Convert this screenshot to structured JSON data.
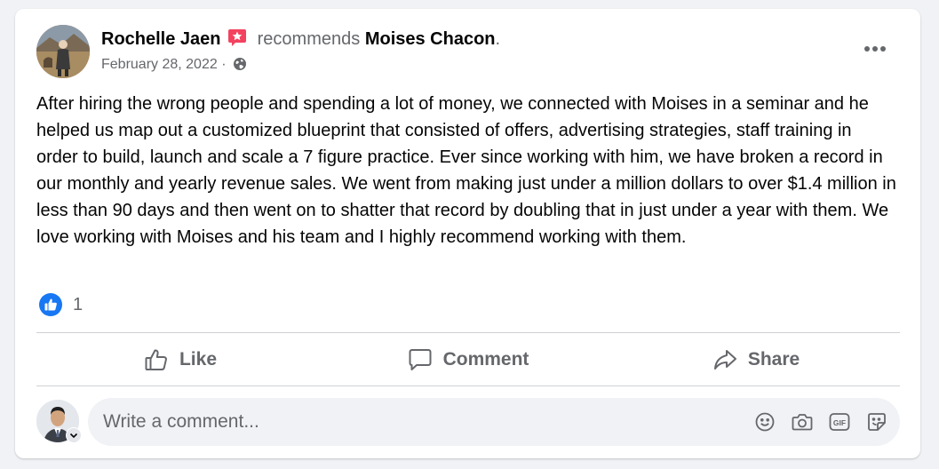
{
  "post": {
    "author_name": "Rochelle Jaen",
    "verb": "recommends",
    "target_name": "Moises Chacon",
    "trailing_dot": ".",
    "date": "February 28, 2022",
    "date_separator": "·",
    "audience_icon": "globe-icon",
    "more_icon": "more-options-icon",
    "body": "After hiring the wrong people and spending a lot of money, we connected with Moises in a seminar and he helped us map out a customized blueprint that consisted of offers, advertising strategies, staff training in order to build, launch and scale a 7 figure practice. Ever since working with him, we have broken a record in our monthly and yearly revenue sales. We went from making just under a million dollars to over $1.4 million in less than 90 days and then went on to shatter that record by doubling that in just under a year with them. We love working with Moises and his team and I highly recommend working with them."
  },
  "reactions": {
    "icon": "like-reaction-icon",
    "count": "1"
  },
  "actions": [
    {
      "label": "Like",
      "icon": "thumbs-up-icon"
    },
    {
      "label": "Comment",
      "icon": "comment-icon"
    },
    {
      "label": "Share",
      "icon": "share-icon"
    }
  ],
  "comment_box": {
    "placeholder": "Write a comment...",
    "tools": [
      "emoji-icon",
      "camera-icon",
      "gif-icon",
      "sticker-icon"
    ]
  },
  "colors": {
    "like_blue": "#1877f2",
    "recommend_badge": "#f3425f",
    "secondary_text": "#65676b",
    "divider": "#ced0d4",
    "page_background": "#f0f2f5"
  }
}
